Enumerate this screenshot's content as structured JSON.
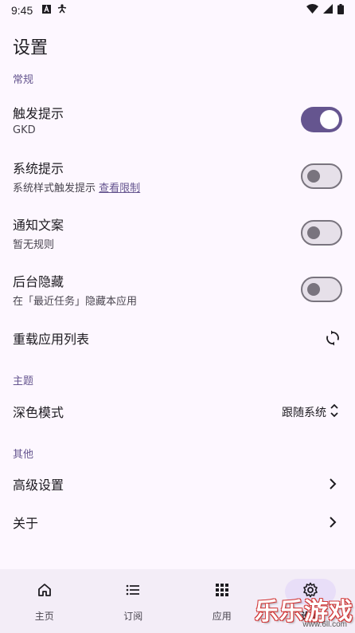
{
  "status_bar": {
    "time": "9:45",
    "left_icons": [
      "font-a-icon",
      "accessibility-icon"
    ],
    "right_icons": [
      "wifi-icon",
      "cellular-icon",
      "battery-icon"
    ]
  },
  "page": {
    "title": "设置"
  },
  "sections": {
    "general": "常规",
    "theme": "主题",
    "other": "其他"
  },
  "settings": {
    "trigger_tip": {
      "title": "触发提示",
      "subtitle": "GKD",
      "enabled": true
    },
    "system_tip": {
      "title": "系统提示",
      "subtitle": "系统样式触发提示",
      "link": "查看限制",
      "enabled": false
    },
    "notification_text": {
      "title": "通知文案",
      "subtitle": "暂无规则",
      "enabled": false
    },
    "background_hide": {
      "title": "后台隐藏",
      "subtitle": "在「最近任务」隐藏本应用",
      "enabled": false
    },
    "reload_apps": {
      "title": "重载应用列表",
      "icon": "refresh-icon"
    },
    "dark_mode": {
      "title": "深色模式",
      "value": "跟随系统",
      "icon": "unfold-icon"
    },
    "advanced": {
      "title": "高级设置",
      "icon": "chevron-right-icon"
    },
    "about": {
      "title": "关于",
      "icon": "chevron-right-icon"
    }
  },
  "bottom_nav": {
    "items": [
      {
        "label": "主页",
        "icon": "home-icon",
        "active": false
      },
      {
        "label": "订阅",
        "icon": "list-icon",
        "active": false
      },
      {
        "label": "应用",
        "icon": "apps-grid-icon",
        "active": false
      },
      {
        "label": "设置",
        "icon": "gear-icon",
        "active": true
      }
    ]
  },
  "watermark": {
    "text": "乐乐游戏",
    "sub": "www.6ll.com"
  },
  "colors": {
    "background": "#fdf7ff",
    "accent": "#65558f",
    "nav_background": "#f3edf7",
    "nav_active_pill": "#e8def8"
  }
}
